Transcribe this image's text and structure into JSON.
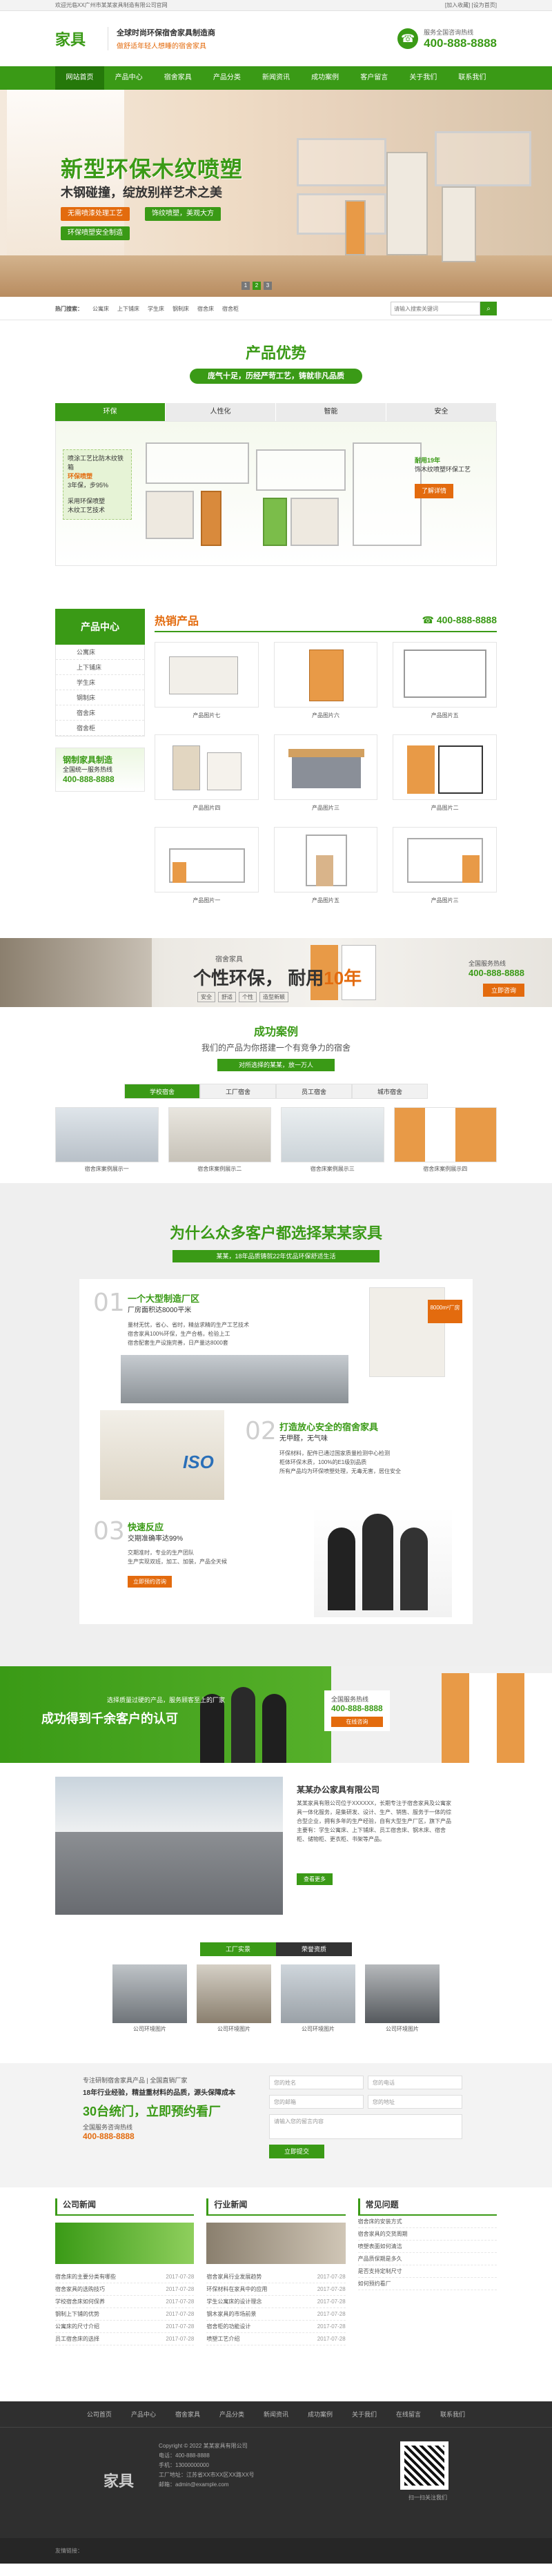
{
  "topbar": {
    "left": "欢迎光临XX广州市某某家具制造有限公司官网",
    "right": "[加入收藏] [设为首页]"
  },
  "header": {
    "logo": "家具",
    "slogan_1": "全球时尚环保宿舍家具制造商",
    "slogan_2": "做舒适年轻人想睡的宿舍家具",
    "hotline_label": "服务全国咨询热线",
    "hotline_number": "400-888-8888"
  },
  "nav": {
    "items": [
      "网站首页",
      "产品中心",
      "宿舍家具",
      "产品分类",
      "新闻资讯",
      "成功案例",
      "客户留言",
      "关于我们",
      "联系我们"
    ]
  },
  "banner": {
    "title": "新型环保木纹喷塑",
    "subtitle": "木钢碰撞，绽放别样艺术之美",
    "tag1": "无需喷漆处理工艺",
    "tag2": "饰纹喷塑，美观大方",
    "tag3": "环保喷塑安全制造",
    "dots": [
      "1",
      "2",
      "3"
    ]
  },
  "searchbar": {
    "label": "热门搜索：",
    "keywords": [
      "公寓床",
      "上下铺床",
      "学生床",
      "钢制床",
      "宿舍床",
      "宿舍柜"
    ],
    "placeholder": "请输入搜索关键词"
  },
  "advantages": {
    "title": "产品优势",
    "badge": "庞气十足，历经严苛工艺，铸就非凡品质",
    "tabs": [
      "环保",
      "人性化",
      "智能",
      "安全"
    ],
    "left_lines": [
      "喷涂工艺比防木纹铁箱",
      "环保喷塑",
      "3年保，步95%"
    ],
    "left_lines2": [
      "采用环保喷塑",
      "木纹工艺技术"
    ],
    "right_title": "耐用19年",
    "right_body": "饰木纹喷塑环保工艺",
    "right_button": "了解详情"
  },
  "hot": {
    "side_title": "产品中心",
    "side_items": [
      "公寓床",
      "上下铺床",
      "学生床",
      "钢制床",
      "宿舍床",
      "宿舍柜"
    ],
    "contact_title": "钢制家具制造",
    "contact_sub": "全国统一服务热线",
    "contact_phone": "400-888-8888",
    "title": "热销产品",
    "phone": "400-888-8888",
    "products": [
      "产品图片七",
      "产品图片六",
      "产品图片五",
      "产品图片四",
      "产品图片三",
      "产品图片二",
      "产品图片一",
      "产品图片五",
      "产品图片三"
    ]
  },
  "promo": {
    "small": "宿舍家具",
    "big_a": "个性环保，",
    "big_b": "耐用",
    "big_c": "10年",
    "tags": [
      "安全",
      "舒适",
      "个性",
      "造型新颖"
    ],
    "phone_label": "全国服务热线",
    "phone": "400-888-8888",
    "button": "立即咨询"
  },
  "cases": {
    "title": "成功案例",
    "sub": "我们的产品为你搭建一个有竞争力的宿舍",
    "sub2": "对所选择的某某，放一万人",
    "tabs": [
      "学校宿舍",
      "工厂宿舍",
      "员工宿舍",
      "城市宿舍"
    ],
    "items": [
      "宿舍床案例展示一",
      "宿舍床案例展示二",
      "宿舍床案例展示三",
      "宿舍床案例展示四"
    ]
  },
  "why": {
    "title": "为什么众多客户都选择某某家具",
    "bar": "某某，18年品质铸就22年优品环保舒适生活",
    "n1": "01",
    "t1": "一个大型制造厂区",
    "s1": "厂房面积达8000平米",
    "b1": [
      "量材无忧，省心、省时，精益求精的生产工艺技术",
      "宿舍家具100%环保，生产合格，检验上工",
      "宿舍配套生产设施完善，日产量达8000套"
    ],
    "badge1": "8000m²厂房",
    "n2": "02",
    "t2": "打造放心安全的宿舍家具",
    "s2": "无甲醛，无气味",
    "b2": [
      "环保材料，配件已通过国家质量检测中心检测",
      "柜体环保木质，100%的E1级别品质",
      "所有产品均为环保喷塑处理，无毒无害，居住安全"
    ],
    "n3": "03",
    "t3": "快速反应",
    "s3": "交期准确率达99%",
    "b3": [
      "交期准时，专业的生产团队",
      "生产实现双班，加工、加装，产品全天候"
    ],
    "btn3": "立即预约咨询"
  },
  "band": {
    "t1": "选择质量过硬的产品，服务顾客至上的厂家",
    "t2": "成功得到千余客户的认可",
    "phone_label": "全国服务热线",
    "phone": "400-888-8888",
    "button": "在线咨询"
  },
  "company": {
    "name": "某某办公家具有限公司",
    "desc": "某某家具有限公司位于XXXXXX，长期专注于宿舍家具及公寓家具一体化服务，是集研发、设计、生产、销售、服务于一体的综合型企业，拥有多年的生产经验，自有大型生产厂区，旗下产品主要有：学生公寓床、上下铺床、员工宿舍床、钢木床、宿舍柜、储物柜、更衣柜、书架等产品。",
    "more": "查看更多"
  },
  "factory": {
    "tabs": [
      "工厂实景",
      "荣誉资质"
    ],
    "items": [
      "公司环境图片",
      "公司环境图片",
      "公司环境图片",
      "公司环境图片"
    ]
  },
  "message": {
    "l1": "专注研制宿舍家具产品 | 全国直销厂家",
    "l2": "18年行业经验，精益重材料的品质，源头保障成本",
    "l3": "30台统门，立即预约看厂",
    "l4": "全国服务咨询热线",
    "l4_phone": "400-888-8888",
    "fields": [
      "您的姓名",
      "您的电话",
      "您的邮箱",
      "您的地址"
    ],
    "textarea": "请输入您的留言内容",
    "submit": "立即提交"
  },
  "news": {
    "cols": [
      {
        "title": "公司新闻",
        "items": [
          {
            "t": "宿舍床的主要分类有哪些",
            "d": "2017-07-28"
          },
          {
            "t": "宿舍家具的选购技巧",
            "d": "2017-07-28"
          },
          {
            "t": "学校宿舍床如何保养",
            "d": "2017-07-28"
          },
          {
            "t": "钢制上下铺的优势",
            "d": "2017-07-28"
          },
          {
            "t": "公寓床的尺寸介绍",
            "d": "2017-07-28"
          },
          {
            "t": "员工宿舍床的选择",
            "d": "2017-07-28"
          }
        ]
      },
      {
        "title": "行业新闻",
        "items": [
          {
            "t": "宿舍家具行业发展趋势",
            "d": "2017-07-28"
          },
          {
            "t": "环保材料在家具中的应用",
            "d": "2017-07-28"
          },
          {
            "t": "学生公寓床的设计理念",
            "d": "2017-07-28"
          },
          {
            "t": "钢木家具的市场前景",
            "d": "2017-07-28"
          },
          {
            "t": "宿舍柜的功能设计",
            "d": "2017-07-28"
          },
          {
            "t": "喷塑工艺介绍",
            "d": "2017-07-28"
          }
        ]
      },
      {
        "title": "常见问题",
        "items": [
          {
            "t": "宿舍床的安装方式",
            "d": ""
          },
          {
            "t": "宿舍家具的交货周期",
            "d": ""
          },
          {
            "t": "喷塑表面如何清洁",
            "d": ""
          },
          {
            "t": "产品质保期是多久",
            "d": ""
          },
          {
            "t": "是否支持定制尺寸",
            "d": ""
          },
          {
            "t": "如何预约看厂",
            "d": ""
          }
        ]
      }
    ]
  },
  "footer": {
    "nav": [
      "公司首页",
      "产品中心",
      "宿舍家具",
      "产品分类",
      "新闻资讯",
      "成功案例",
      "关于我们",
      "在线留言",
      "联系我们"
    ],
    "logo": "家具",
    "info": [
      "Copyright © 2022 某某家具有限公司",
      "电话：400-888-8888",
      "手机：13000000000",
      "工厂地址：江苏省XX市XX区XX路XX号",
      "邮箱：admin@example.com"
    ],
    "qr_caption": "扫一扫关注我们",
    "bottom": "友情链接："
  }
}
